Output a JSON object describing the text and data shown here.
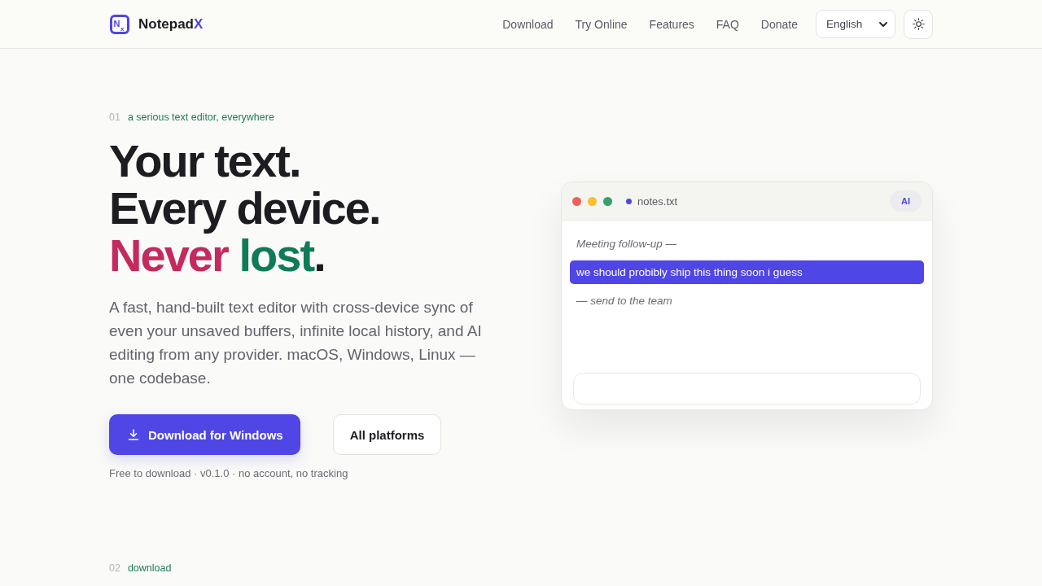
{
  "header": {
    "brand": {
      "logo_letter": "N",
      "logo_sub": "x",
      "name": "Notepad",
      "accent": "X"
    },
    "nav": [
      "Download",
      "Try Online",
      "Features",
      "FAQ",
      "Donate"
    ],
    "language": {
      "value": "English"
    }
  },
  "hero": {
    "eyebrow": {
      "number": "01",
      "label": "a serious text editor, everywhere"
    },
    "headline": [
      {
        "segments": [
          {
            "text": "Your text.",
            "color": "#1c1c21"
          }
        ]
      },
      {
        "segments": [
          {
            "text": "Every device.",
            "color": "#1c1c21"
          }
        ]
      },
      {
        "segments": [
          {
            "text": "Never ",
            "color": "#c4295f"
          },
          {
            "text": "lost",
            "color": "#0f7b58"
          },
          {
            "text": ".",
            "color": "#1c1c21"
          }
        ]
      }
    ],
    "description": "A fast, hand-built text editor with cross-device sync of even your unsaved buffers, infinite local history, and AI editing from any provider. macOS, Windows, Linux — one codebase.",
    "actions": [
      {
        "label": "Download for Windows",
        "kind": "primary"
      },
      {
        "label": "All platforms",
        "kind": "secondary"
      }
    ],
    "note": "Free to download · v0.1.0 · no account, no tracking"
  },
  "editor_preview": {
    "window_controls": [
      {
        "color": "#f25f58"
      },
      {
        "color": "#fbbf2e"
      },
      {
        "color": "#38a06b"
      }
    ],
    "unsaved": true,
    "file_name": "notes.txt",
    "ai_badge": "AI",
    "lines": [
      {
        "text": "Meeting follow-up —",
        "selected": false
      },
      {
        "text": "we should probibly ship this thing soon i guess",
        "selected": true
      },
      {
        "text": "— send to the team",
        "selected": false
      }
    ]
  },
  "next_section": {
    "number": "02",
    "label": "download"
  }
}
